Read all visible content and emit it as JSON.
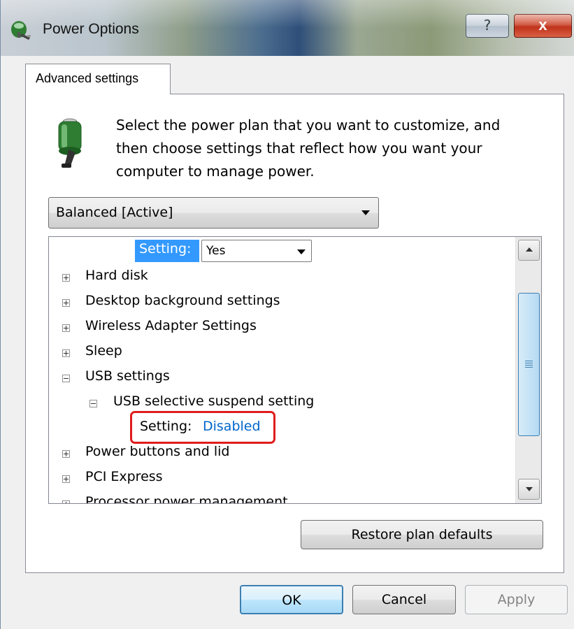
{
  "window": {
    "title": "Power Options",
    "help_label": "?",
    "close_label": "x"
  },
  "tab": {
    "label": "Advanced settings"
  },
  "description": "Select the power plan that you want to customize, and then choose settings that reflect how you want your computer to manage power.",
  "plan_select": {
    "value": "Balanced [Active]"
  },
  "tree": {
    "top_setting": {
      "label": "Setting:",
      "value": "Yes"
    },
    "items": [
      {
        "label": "Hard disk",
        "state": "collapsed"
      },
      {
        "label": "Desktop background settings",
        "state": "collapsed"
      },
      {
        "label": "Wireless Adapter Settings",
        "state": "collapsed"
      },
      {
        "label": "Sleep",
        "state": "collapsed"
      },
      {
        "label": "USB settings",
        "state": "expanded"
      },
      {
        "label": "USB selective suspend setting",
        "state": "expanded"
      },
      {
        "label": "Setting:",
        "value": "Disabled"
      },
      {
        "label": "Power buttons and lid",
        "state": "collapsed"
      },
      {
        "label": "PCI Express",
        "state": "collapsed"
      },
      {
        "label": "Processor power management",
        "state": "collapsed"
      }
    ]
  },
  "buttons": {
    "restore": "Restore plan defaults",
    "ok": "OK",
    "cancel": "Cancel",
    "apply": "Apply"
  },
  "colors": {
    "selection": "#3399ff",
    "link_value": "#0066cc",
    "highlight_box": "#e01c1c"
  }
}
